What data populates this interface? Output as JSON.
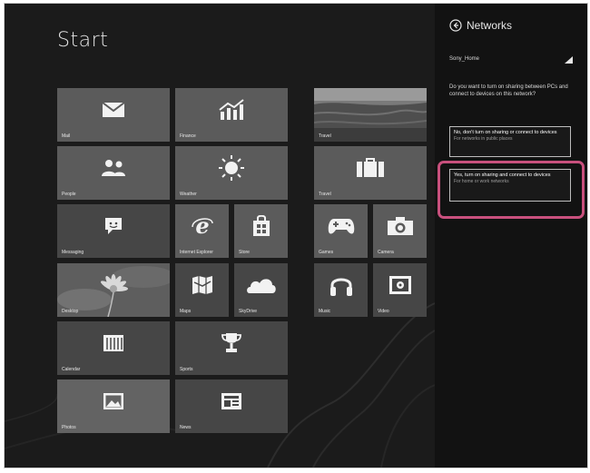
{
  "start": {
    "title": "Start",
    "tiles": [
      {
        "name": "tile-mail",
        "label": "Mail",
        "icon": "mail-icon"
      },
      {
        "name": "tile-finance",
        "label": "Finance",
        "icon": "chart-icon"
      },
      {
        "name": "tile-travel",
        "label": "Travel",
        "icon": "photo-icon"
      },
      {
        "name": "tile-people",
        "label": "People",
        "icon": "people-icon"
      },
      {
        "name": "tile-weather",
        "label": "Weather",
        "icon": "sun-icon"
      },
      {
        "name": "tile-travel-2",
        "label": "Travel",
        "icon": "suitcase-icon"
      },
      {
        "name": "tile-messaging",
        "label": "Messaging",
        "icon": "chat-icon"
      },
      {
        "name": "tile-internet-explorer",
        "label": "Internet Explorer",
        "icon": "ie-icon"
      },
      {
        "name": "tile-store",
        "label": "Store",
        "icon": "store-icon"
      },
      {
        "name": "tile-games",
        "label": "Games",
        "icon": "gamepad-icon"
      },
      {
        "name": "tile-camera",
        "label": "Camera",
        "icon": "camera-icon"
      },
      {
        "name": "tile-desktop",
        "label": "Desktop",
        "icon": "flower-image"
      },
      {
        "name": "tile-maps",
        "label": "Maps",
        "icon": "map-icon"
      },
      {
        "name": "tile-skydrive",
        "label": "SkyDrive",
        "icon": "cloud-icon"
      },
      {
        "name": "tile-music",
        "label": "Music",
        "icon": "headphones-icon"
      },
      {
        "name": "tile-video",
        "label": "Video",
        "icon": "video-icon"
      },
      {
        "name": "tile-calendar",
        "label": "Calendar",
        "icon": "calendar-icon"
      },
      {
        "name": "tile-sports",
        "label": "Sports",
        "icon": "trophy-icon"
      },
      {
        "name": "tile-photos",
        "label": "Photos",
        "icon": "picture-icon"
      },
      {
        "name": "tile-news",
        "label": "News",
        "icon": "newspaper-icon"
      }
    ]
  },
  "charms": {
    "title": "Networks",
    "icon": "back-arrow-icon",
    "network_name": "Sony_Home",
    "question": "Do you want to turn on sharing between PCs and connect to devices on this network?",
    "option_no": {
      "main": "No, don't turn on sharing or connect to devices",
      "sub": "For networks in public places"
    },
    "option_yes": {
      "main": "Yes, turn on sharing and connect to devices",
      "sub": "For home or work networks"
    }
  },
  "colors": {
    "tile": "#5b5b5b",
    "background": "#1b1b1b",
    "charms_background": "#121212",
    "highlight": "#c8507d"
  }
}
